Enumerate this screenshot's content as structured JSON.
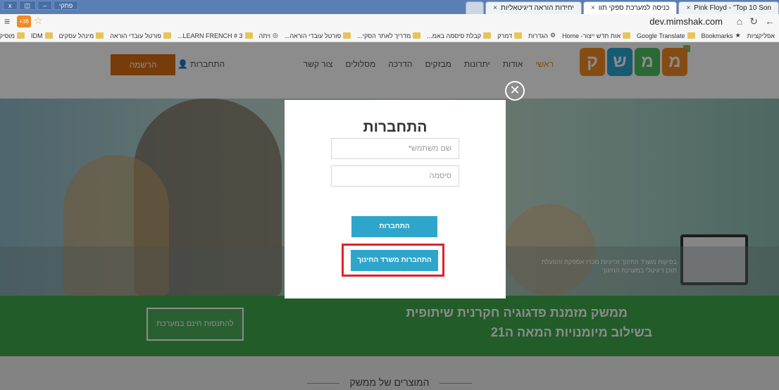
{
  "browser": {
    "window_controls": [
      "x",
      "◫",
      "–",
      "פתקי"
    ],
    "tabs": [
      {
        "label": "Pink Floyd - \"Top 10 Son",
        "active": false
      },
      {
        "label": "כניסה למערכת ספקי תוו",
        "active": true
      },
      {
        "label": "יחידות הוראה דיגיטאליות",
        "active": false
      }
    ],
    "url": "dev.mimshak.com",
    "ext_badge": "+36",
    "bookmarks": [
      "אפליקציות",
      "Bookmarks",
      "Google Translate",
      "אות חדש ייצור- Home",
      "הגדרות",
      "דמרק",
      "קבלת סיסמה באמ...",
      "מדריך לאתר הסקי...",
      "פורטל עובדי הוראה...",
      "ויתה",
      "LEARN FRENCH # 3...",
      "פורטל עובדי הוראה",
      "מינהל עסקים",
      "IDM",
      "מוסיקה"
    ]
  },
  "site": {
    "logo_letters": [
      "מ",
      "מ",
      "ש",
      "ק"
    ],
    "nav": [
      "ראשי",
      "אודות",
      "יתרונות",
      "מבזקים",
      "הדרכה",
      "מסלולים",
      "צור קשר"
    ],
    "login_link": "התחברות",
    "register_label": "הרשמה"
  },
  "hero": {
    "moe_text": "בפיקוח משרד החינוך זכייניות מכרז אספקת והפעלת תוכן דיגיטלי במערכת החינוך"
  },
  "band": {
    "line1": "ממשק מזמנת פדגוגיה חקרנית שיתופית",
    "line2": "בשילוב מיומנויות המאה ה21",
    "button_label": "להתנסות חינם במערכת"
  },
  "products_title": "המוצרים של ממשק",
  "modal": {
    "title": "התחברות",
    "username_placeholder": "שם משתמש*",
    "password_placeholder": "סיסמה",
    "login_button": "התחברות",
    "moe_login_button": "התחברות משרד החינוך",
    "close_symbol": "✕"
  }
}
